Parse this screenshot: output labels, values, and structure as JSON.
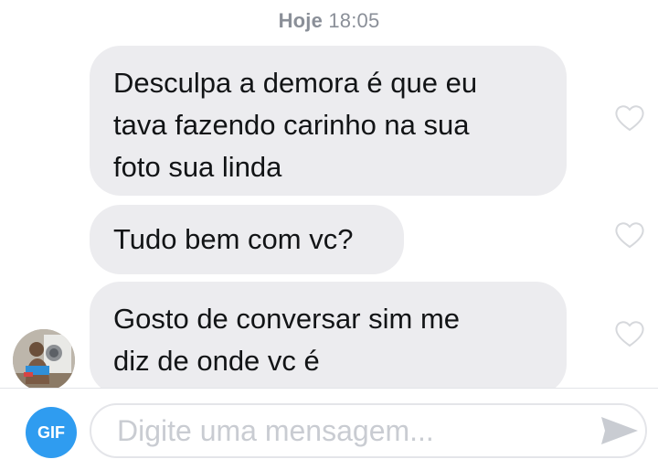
{
  "header": {
    "day": "Hoje",
    "time": "18:05"
  },
  "messages": [
    {
      "line1": "Desculpa a demora é que eu",
      "line2": "tava fazendo carinho na sua",
      "line3": "foto sua linda",
      "liked": false
    },
    {
      "line1": "Tudo bem com vc?",
      "liked": false
    },
    {
      "line1": "Gosto de conversar sim me",
      "line2": "diz de onde vc é",
      "liked": false
    }
  ],
  "composer": {
    "gif_label": "GIF",
    "placeholder": "Digite uma mensagem...",
    "value": ""
  },
  "colors": {
    "bubble": "#ececef",
    "accent": "#2f9cf0",
    "heart_outline": "#d6d8dc",
    "timestamp": "#8a8f98"
  },
  "icons": {
    "like": "heart-outline-icon",
    "send": "paper-plane-icon",
    "gif": "gif-icon"
  }
}
